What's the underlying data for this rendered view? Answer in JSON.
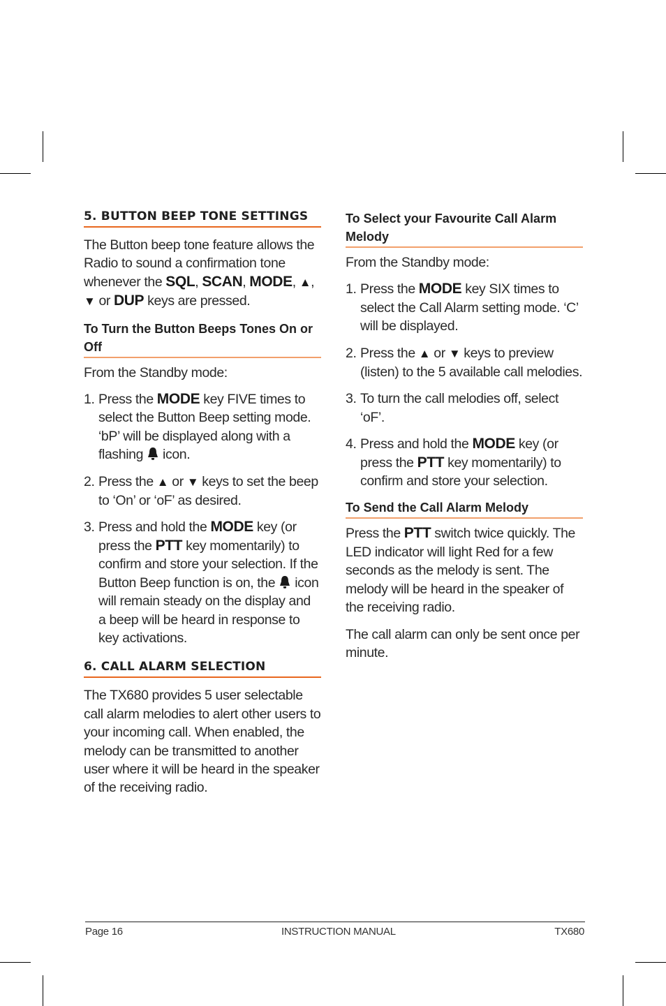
{
  "section5": {
    "heading": "5. BUTTON BEEP TONE SETTINGS",
    "intro": {
      "t1": "The Button beep tone feature allows the Radio to sound a confirmation tone whenever the ",
      "k1": "SQL",
      "s1": ", ",
      "k2": "SCAN",
      "s2": ", ",
      "k3": "MODE",
      "s3": ", ",
      "up": "▲",
      "s4": ", ",
      "down": "▼",
      "s5": " or ",
      "k4": "DUP",
      "t2": " keys are pressed."
    },
    "subheading": "To Turn the Button Beeps Tones On or Off",
    "standby": "From the Standby mode:",
    "steps": [
      {
        "num": "1.",
        "t1": "Press the ",
        "k": "MODE",
        "t2": " key FIVE times to select the Button Beep setting mode. ‘bP’ will be displayed along with a flashing ",
        "t3": " icon."
      },
      {
        "num": "2.",
        "t1": "Press the ",
        "up": "▲",
        "t2": " or ",
        "down": "▼",
        "t3": " keys to set the beep to ‘On’ or ‘oF’ as desired."
      },
      {
        "num": "3.",
        "t1": "Press and hold the ",
        "k1": "MODE",
        "t2": " key (or press the ",
        "k2": "PTT",
        "t3": " key momentarily) to confirm and store your selection. If the Button Beep function is on, the ",
        "t4": " icon will remain steady on the display and a beep will be heard in response to key activations."
      }
    ]
  },
  "section6": {
    "heading": "6. CALL ALARM SELECTION",
    "intro": "The TX680 provides 5 user selectable call alarm melodies to alert other users to your incoming call. When enabled, the melody can be transmitted to another user where it will be heard in the speaker of the receiving radio."
  },
  "favourite": {
    "subheading": "To Select your Favourite Call Alarm Melody",
    "standby": "From the Standby mode:",
    "steps": [
      {
        "num": "1.",
        "t1": "Press the ",
        "k": "MODE",
        "t2": " key SIX times to select the Call Alarm setting mode. ‘C’ will be displayed."
      },
      {
        "num": "2.",
        "t1": "Press the ",
        "up": "▲",
        "t2": " or ",
        "down": "▼",
        "t3": " keys to preview (listen) to the 5 available call melodies."
      },
      {
        "num": "3.",
        "t1": "To turn the call melodies off, select ‘oF’."
      },
      {
        "num": "4.",
        "t1": "Press and hold the ",
        "k1": "MODE",
        "t2": " key (or press the ",
        "k2": "PTT",
        "t3": " key momentarily) to confirm and store your selection."
      }
    ]
  },
  "send": {
    "subheading": "To Send the Call Alarm Melody",
    "p1": {
      "t1": "Press the ",
      "k": "PTT",
      "t2": " switch twice quickly. The LED indicator will light Red for a few seconds as the melody is sent. The melody will be heard in the speaker of the receiving radio."
    },
    "p2": "The call alarm can only be sent once per minute."
  },
  "footer": {
    "page": "Page 16",
    "title": "INSTRUCTION MANUAL",
    "model": "TX680"
  },
  "colors": {
    "heading_rule": "#e8671e",
    "subheading_rule": "#f2a06b"
  }
}
